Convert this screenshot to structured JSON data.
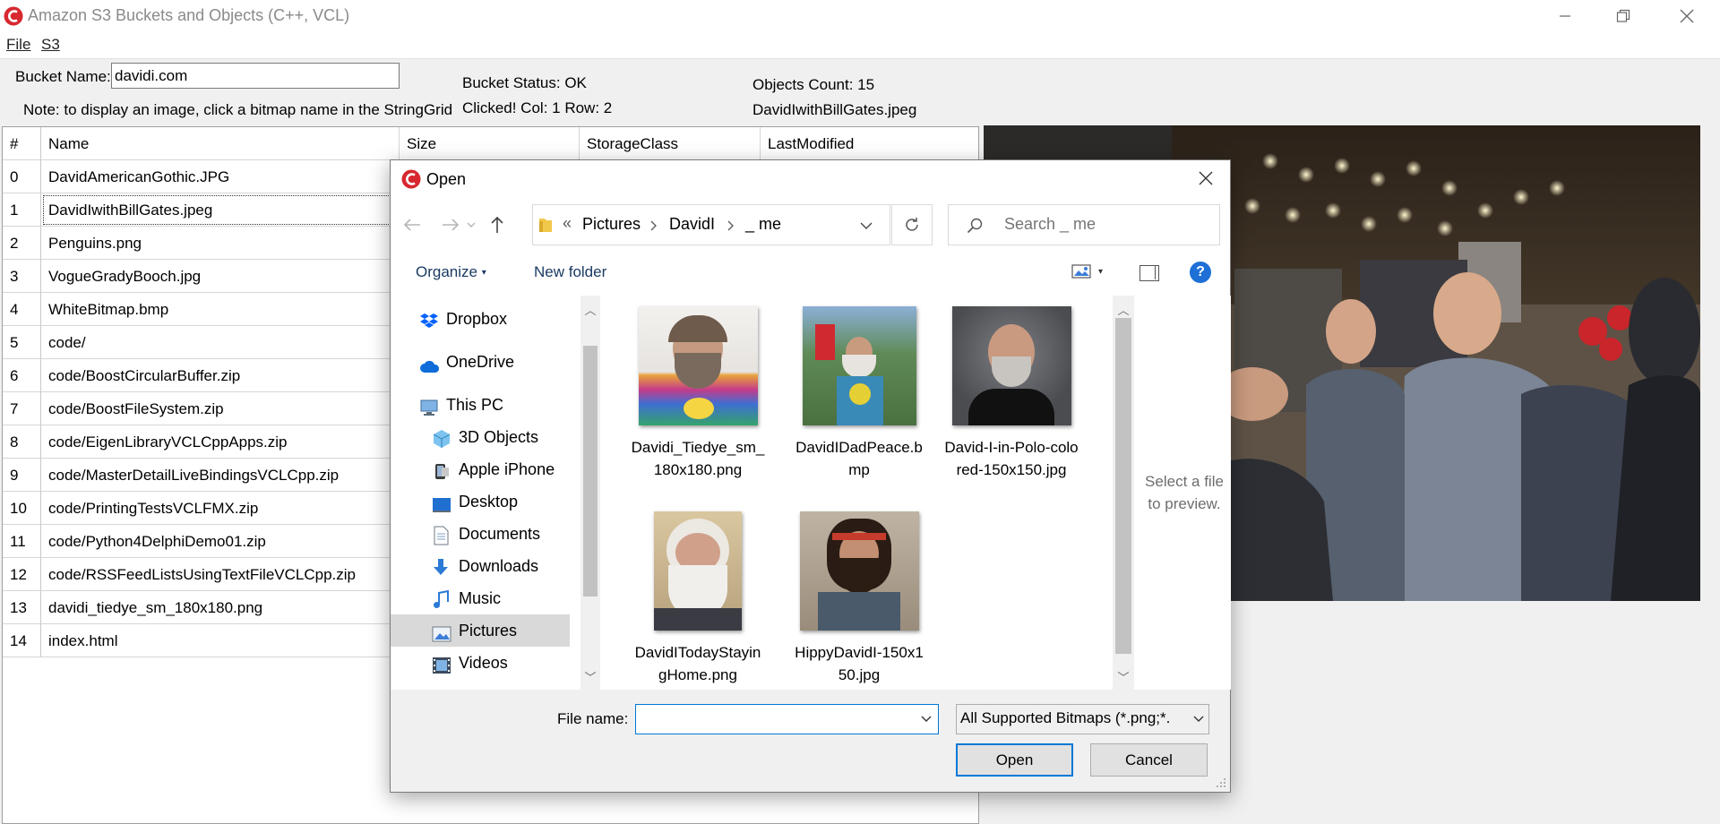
{
  "window": {
    "title": "Amazon S3 Buckets and Objects (C++, VCL)",
    "controls": [
      "minimize-icon",
      "restore-icon",
      "close-icon"
    ]
  },
  "menu": {
    "file": "File",
    "s3": "S3"
  },
  "bucket": {
    "label": "Bucket Name:",
    "value": "davidi.com",
    "status": "Bucket Status: OK",
    "clicked": "Clicked! Col: 1 Row: 2",
    "objects_count": "Objects Count: 15",
    "selected_object": "DavidIwithBillGates.jpeg",
    "note": "Note: to display an image, click a bitmap name in the StringGrid"
  },
  "grid": {
    "columns": [
      "#",
      "Name",
      "Size",
      "StorageClass",
      "LastModified"
    ],
    "rows": [
      [
        "0",
        "DavidAmericanGothic.JPG"
      ],
      [
        "1",
        "DavidIwithBillGates.jpeg"
      ],
      [
        "2",
        "Penguins.png"
      ],
      [
        "3",
        "VogueGradyBooch.jpg"
      ],
      [
        "4",
        "WhiteBitmap.bmp"
      ],
      [
        "5",
        "code/"
      ],
      [
        "6",
        "code/BoostCircularBuffer.zip"
      ],
      [
        "7",
        "code/BoostFileSystem.zip"
      ],
      [
        "8",
        "code/EigenLibraryVCLCppApps.zip"
      ],
      [
        "9",
        "code/MasterDetailLiveBindingsVCLCpp.zip"
      ],
      [
        "10",
        "code/PrintingTestsVCLFMX.zip"
      ],
      [
        "11",
        "code/Python4DelphiDemo01.zip"
      ],
      [
        "12",
        "code/RSSFeedListsUsingTextFileVCLCpp.zip"
      ],
      [
        "13",
        "davidi_tiedye_sm_180x180.png"
      ],
      [
        "14",
        "index.html"
      ]
    ],
    "selected_row": 1
  },
  "dialog": {
    "title": "Open",
    "address": {
      "overflow": "«",
      "crumbs": [
        "Pictures",
        "DavidI",
        "_ me"
      ]
    },
    "search_placeholder": "Search _ me",
    "organize": "Organize",
    "new_folder": "New folder",
    "nav": [
      {
        "label": "Dropbox",
        "icon": "dropbox-icon"
      },
      {
        "label": "OneDrive",
        "icon": "onedrive-icon"
      },
      {
        "label": "This PC",
        "icon": "computer-icon"
      },
      {
        "label": "3D Objects",
        "icon": "cube-icon"
      },
      {
        "label": "Apple iPhone",
        "icon": "phone-icon"
      },
      {
        "label": "Desktop",
        "icon": "desktop-icon"
      },
      {
        "label": "Documents",
        "icon": "document-icon"
      },
      {
        "label": "Downloads",
        "icon": "download-icon"
      },
      {
        "label": "Music",
        "icon": "music-icon"
      },
      {
        "label": "Pictures",
        "icon": "pictures-icon",
        "selected": true
      },
      {
        "label": "Videos",
        "icon": "video-icon"
      }
    ],
    "files": [
      {
        "label": "Davidi_Tiedye_sm_180x180.png"
      },
      {
        "label": "DavidIDadPeace.bmp"
      },
      {
        "label": "David-I-in-Polo-colored-150x150.jpg"
      },
      {
        "label": "DavidITodayStayingHome.png"
      },
      {
        "label": "HippyDavidI-150x150.jpg"
      }
    ],
    "preview_message": "Select a file to preview.",
    "filename_label": "File name:",
    "filename_value": "",
    "filetype": "All Supported Bitmaps (*.png;*.",
    "open_button": "Open",
    "cancel_button": "Cancel"
  },
  "colors": {
    "accent": "#0078d7",
    "help": "#1e6fd6",
    "logo": "#d7282f"
  }
}
